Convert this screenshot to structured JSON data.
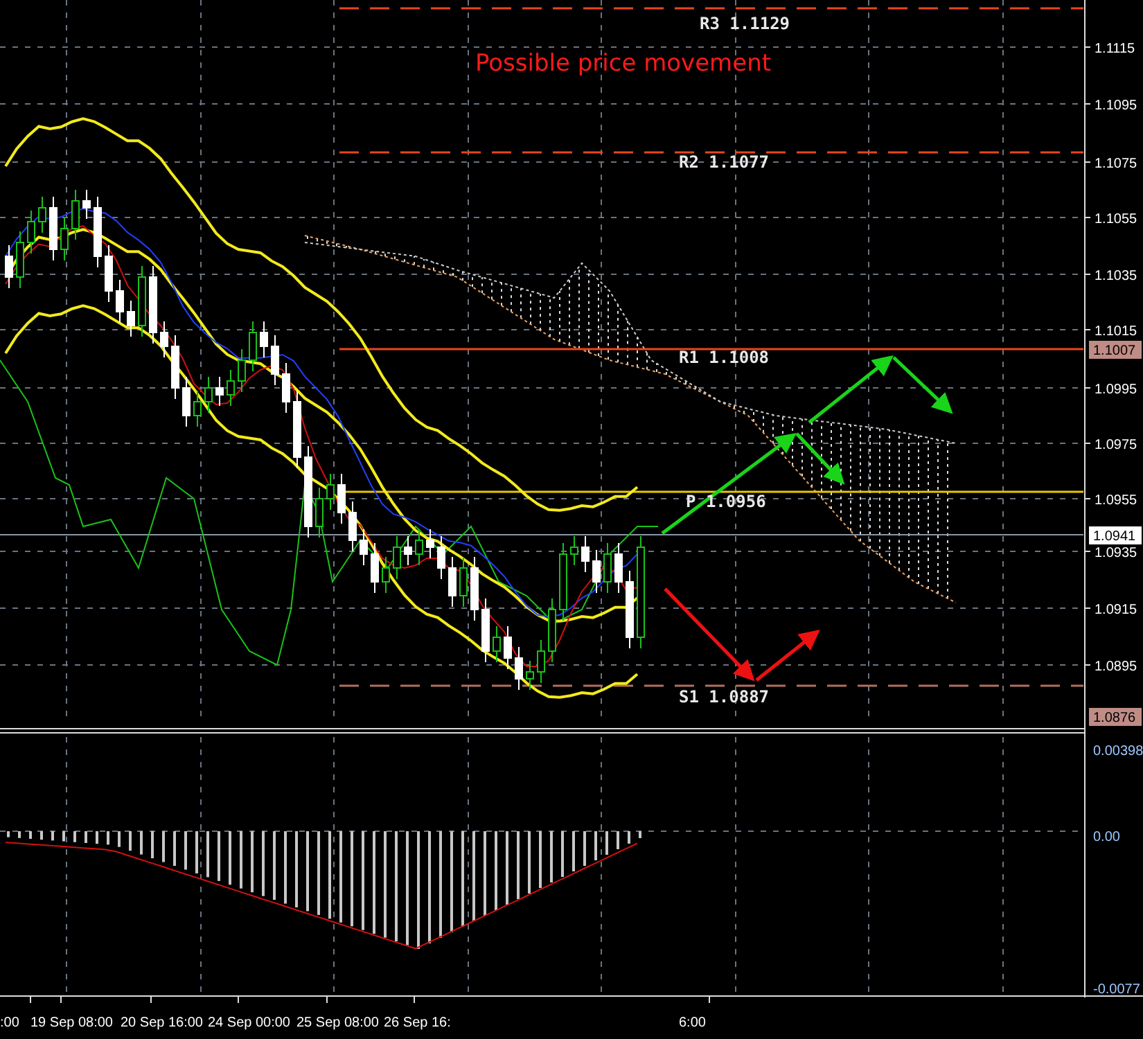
{
  "annotation": "Possible price movement",
  "levels": [
    {
      "label": "R3 1.1129",
      "kind": "resistance"
    },
    {
      "label": "R2 1.1077",
      "kind": "resistance"
    },
    {
      "label": "R1 1.1008",
      "kind": "resistance"
    },
    {
      "label": "P 1.0956",
      "kind": "pivot"
    },
    {
      "label": "S1 1.0887",
      "kind": "support"
    }
  ],
  "price_axis": {
    "ticks": [
      "1.1115",
      "1.1095",
      "1.1075",
      "1.1055",
      "1.1035",
      "1.1015",
      "1.0995",
      "1.0975",
      "1.0955",
      "1.0935",
      "1.0915",
      "1.0895"
    ],
    "markers": [
      {
        "label": "1.1007",
        "kind": "level"
      },
      {
        "label": "1.0941",
        "kind": "current"
      },
      {
        "label": "1.0876",
        "kind": "level"
      }
    ]
  },
  "macd_axis": {
    "ticks": [
      "0.00398",
      "0.00",
      "-0.0077"
    ]
  },
  "time_axis": {
    "labels": [
      ":00",
      "19 Sep 08:00",
      "20 Sep 16:00",
      "24 Sep 00:00",
      "25 Sep 08:00",
      "26 Sep 16:",
      "6:00"
    ]
  }
}
